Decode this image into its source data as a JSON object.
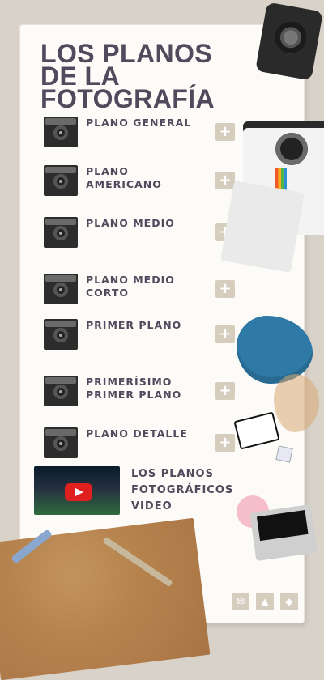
{
  "title": "LOS PLANOS DE LA FOTOGRAFÍA",
  "items": [
    {
      "label": "PLANO GENERAL",
      "plus": "+"
    },
    {
      "label": "PLANO\nAMERICANO",
      "plus": "+"
    },
    {
      "label": "PLANO MEDIO",
      "plus": "+"
    },
    {
      "label": "PLANO MEDIO\nCORTO",
      "plus": "+"
    },
    {
      "label": "PRIMER PLANO",
      "plus": "+"
    },
    {
      "label": "PRIMERÍSIMO\nPRIMER PLANO",
      "plus": "+"
    },
    {
      "label": "PLANO DETALLE",
      "plus": "+"
    }
  ],
  "video": {
    "label": "LOS PLANOS\nFOTOGRÁFICOS\nVIDEO"
  },
  "colors": {
    "title": "#4f4a5c",
    "plus_bg": "#d6cdbf",
    "paper": "#fcfbf8",
    "background": "#d9d2c9"
  },
  "icons": {
    "item_thumb": "camera-thumbnail-icon",
    "plus": "plus-icon",
    "video_play": "youtube-play-icon",
    "email": "email-icon",
    "drive": "drive-icon",
    "dropbox": "dropbox-icon"
  }
}
